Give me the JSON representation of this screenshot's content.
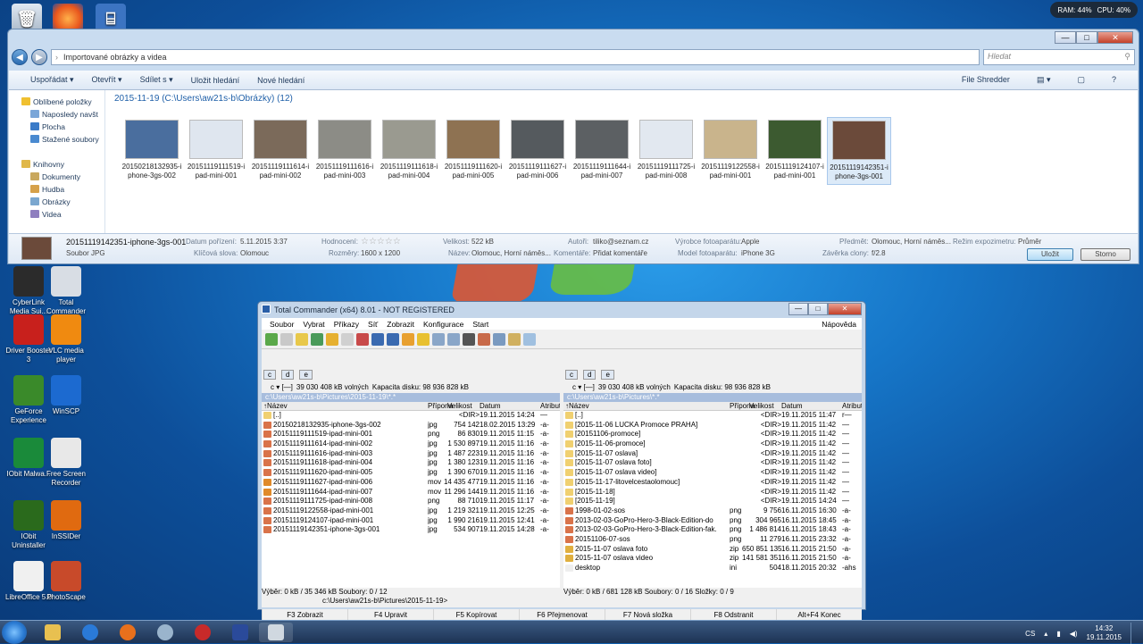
{
  "perf": {
    "ram": "RAM: 44%",
    "cpu": "CPU: 40%"
  },
  "desktop": {
    "icons": [
      "CyberLink Media Sui...",
      "Total Commander",
      "Driver Booster 3",
      "VLC media player",
      "GeForce Experience",
      "WinSCP",
      "IObit Malwa...",
      "Free Screen Recorder",
      "IObit Uninstaller",
      "InSSIDer",
      "LibreOffice 5.0",
      "PhotoScape"
    ]
  },
  "explorer": {
    "address": "Importované obrázky a videa",
    "search_placeholder": "Hledat",
    "toolbar": [
      "Uspořádat ▾",
      "Otevřít ▾",
      "Sdílet s ▾",
      "Uložit hledání",
      "Nové hledání"
    ],
    "toolbar_right": "File Shredder",
    "nav": [
      {
        "label": "Oblíbené položky",
        "sub": false,
        "color": "#f0c030"
      },
      {
        "label": "Naposledy navšt",
        "sub": true,
        "color": "#7aa6d8"
      },
      {
        "label": "Plocha",
        "sub": true,
        "color": "#3a7bc8"
      },
      {
        "label": "Stažené soubory",
        "sub": true,
        "color": "#4a8ad0"
      },
      {
        "label": "",
        "sub": false,
        "color": ""
      },
      {
        "label": "Knihovny",
        "sub": false,
        "color": "#e0b84a"
      },
      {
        "label": "Dokumenty",
        "sub": true,
        "color": "#c9a85e"
      },
      {
        "label": "Hudba",
        "sub": true,
        "color": "#d6a14a"
      },
      {
        "label": "Obrázky",
        "sub": true,
        "color": "#7ba7cf"
      },
      {
        "label": "Videa",
        "sub": true,
        "color": "#8f7fbf"
      }
    ],
    "breadcrumb": "2015-11-19 (C:\\Users\\aw21s-b\\Obrázky) (12)",
    "thumbs": [
      {
        "name": "20150218132935-iphone-3gs-002",
        "line1": "20150218132935-i",
        "line2": "phone-3gs-002",
        "color": "#4a6e9e"
      },
      {
        "name": "20151119111519-ipad-mini-001",
        "line1": "20151119111519-i",
        "line2": "pad-mini-001",
        "color": "#dfe6ef"
      },
      {
        "name": "20151119111614-ipad-mini-002",
        "line1": "20151119111614-i",
        "line2": "pad-mini-002",
        "color": "#7b6a5a"
      },
      {
        "name": "20151119111616-ipad-mini-003",
        "line1": "20151119111616-i",
        "line2": "pad-mini-003",
        "color": "#8c8c86"
      },
      {
        "name": "20151119111618-ipad-mini-004",
        "line1": "20151119111618-i",
        "line2": "pad-mini-004",
        "color": "#9a9a90"
      },
      {
        "name": "20151119111620-ipad-mini-005",
        "line1": "20151119111620-i",
        "line2": "pad-mini-005",
        "color": "#8e7252"
      },
      {
        "name": "20151119111627-ipad-mini-006",
        "line1": "20151119111627-i",
        "line2": "pad-mini-006",
        "color": "#555a5e"
      },
      {
        "name": "20151119111644-ipad-mini-007",
        "line1": "20151119111644-i",
        "line2": "pad-mini-007",
        "color": "#5c6063"
      },
      {
        "name": "20151119111725-ipad-mini-008",
        "line1": "20151119111725-i",
        "line2": "pad-mini-008",
        "color": "#e2e8f0"
      },
      {
        "name": "20151119122558-ipad-mini-001",
        "line1": "20151119122558-i",
        "line2": "pad-mini-001",
        "color": "#c9b48c"
      },
      {
        "name": "20151119124107-ipad-mini-001",
        "line1": "20151119124107-i",
        "line2": "pad-mini-001",
        "color": "#3c5a30"
      },
      {
        "name": "20151119142351-iphone-3gs-001",
        "line1": "20151119142351-i",
        "line2": "phone-3gs-001",
        "color": "#6b4a3a"
      }
    ],
    "details": {
      "filename": "20151119142351-iphone-3gs-001",
      "filetype": "Soubor JPG",
      "date_label": "Datum pořízení:",
      "date_value": "5.11.2015 3:37",
      "keywords_label": "Klíčová slova:",
      "keywords_value": "Olomouc",
      "rating_label": "Hodnocení:",
      "rating_stars": "☆☆☆☆☆",
      "dims_label": "Rozměry:",
      "dims_value": "1600 x 1200",
      "size_label": "Velikost:",
      "size_value": "522 kB",
      "title_label": "Název:",
      "title_value": "Olomouc, Horní náměs...",
      "author_label": "Autoři:",
      "author_value": "tiliko@seznam.cz",
      "comments_label": "Komentáře:",
      "comments_value": "Přidat komentáře",
      "maker_label": "Výrobce fotoaparátu:",
      "maker_value": "Apple",
      "model_label": "Model fotoaparátu:",
      "model_value": "iPhone 3G",
      "subject_label": "Předmět:",
      "subject_value": "Olomouc, Horní náměs...",
      "aperture_label": "Závěrka clony:",
      "aperture_value": "f/2.8",
      "exposure_label": "Režim expozimetru:",
      "exposure_value": "Průměr",
      "save": "Uložit",
      "cancel": "Storno"
    }
  },
  "tc": {
    "title": "Total Commander (x64) 8.01 - NOT REGISTERED",
    "menu": [
      "Soubor",
      "Vybrat",
      "Příkazy",
      "Síť",
      "Zobrazit",
      "Konfigurace",
      "Start"
    ],
    "help": "Nápověda",
    "drives": [
      "c",
      "d",
      "e"
    ],
    "disk_free": "39 030 408 kB volných",
    "disk_cap": "Kapacita disku: 98 936 828 kB",
    "left": {
      "path": "c:\\Users\\aw21s-b\\Pictures\\2015-11-19\\*.*",
      "columns": {
        "name": "↑Název",
        "ext": "Přípona",
        "size": "Velikost",
        "date": "Datum",
        "attr": "Atributy"
      },
      "rows": [
        {
          "name": "[..]",
          "ext": "",
          "size": "<DIR>",
          "date": "19.11.2015 14:24",
          "attr": "—",
          "color": "#f0d070"
        },
        {
          "name": "20150218132935-iphone-3gs-002",
          "ext": "jpg",
          "size": "754 142",
          "date": "18.02.2015 13:29",
          "attr": "-a-",
          "color": "#d9734a"
        },
        {
          "name": "20151119111519-ipad-mini-001",
          "ext": "png",
          "size": "86 830",
          "date": "19.11.2015 11:15",
          "attr": "-a-",
          "color": "#d9734a"
        },
        {
          "name": "20151119111614-ipad-mini-002",
          "ext": "jpg",
          "size": "1 530 897",
          "date": "19.11.2015 11:16",
          "attr": "-a-",
          "color": "#d9734a"
        },
        {
          "name": "20151119111616-ipad-mini-003",
          "ext": "jpg",
          "size": "1 487 223",
          "date": "19.11.2015 11:16",
          "attr": "-a-",
          "color": "#d9734a"
        },
        {
          "name": "20151119111618-ipad-mini-004",
          "ext": "jpg",
          "size": "1 380 123",
          "date": "19.11.2015 11:16",
          "attr": "-a-",
          "color": "#d9734a"
        },
        {
          "name": "20151119111620-ipad-mini-005",
          "ext": "jpg",
          "size": "1 390 670",
          "date": "19.11.2015 11:16",
          "attr": "-a-",
          "color": "#d9734a"
        },
        {
          "name": "20151119111627-ipad-mini-006",
          "ext": "mov",
          "size": "14 435 477",
          "date": "19.11.2015 11:16",
          "attr": "-a-",
          "color": "#e08a2a"
        },
        {
          "name": "20151119111644-ipad-mini-007",
          "ext": "mov",
          "size": "11 296 144",
          "date": "19.11.2015 11:16",
          "attr": "-a-",
          "color": "#e08a2a"
        },
        {
          "name": "20151119111725-ipad-mini-008",
          "ext": "png",
          "size": "88 710",
          "date": "19.11.2015 11:17",
          "attr": "-a-",
          "color": "#d9734a"
        },
        {
          "name": "20151119122558-ipad-mini-001",
          "ext": "jpg",
          "size": "1 219 321",
          "date": "19.11.2015 12:25",
          "attr": "-a-",
          "color": "#d9734a"
        },
        {
          "name": "20151119124107-ipad-mini-001",
          "ext": "jpg",
          "size": "1 990 216",
          "date": "19.11.2015 12:41",
          "attr": "-a-",
          "color": "#d9734a"
        },
        {
          "name": "20151119142351-iphone-3gs-001",
          "ext": "jpg",
          "size": "534 907",
          "date": "19.11.2015 14:28",
          "attr": "-a-",
          "color": "#d9734a"
        }
      ],
      "status": "Výběr: 0 kB / 35 346 kB   Soubory: 0 / 12"
    },
    "right": {
      "path": "c:\\Users\\aw21s-b\\Pictures\\*.*",
      "columns": {
        "name": "↑Název",
        "ext": "Přípona",
        "size": "Velikost",
        "date": "Datum",
        "attr": "Atributy"
      },
      "rows": [
        {
          "name": "[..]",
          "ext": "",
          "size": "<DIR>",
          "date": "19.11.2015 11:47",
          "attr": "r—",
          "color": "#f0d070"
        },
        {
          "name": "[2015-11-06 LUCKA Promoce PRAHA]",
          "ext": "",
          "size": "<DIR>",
          "date": "19.11.2015 11:42",
          "attr": "—",
          "color": "#f0d070"
        },
        {
          "name": "[20151106-promoce]",
          "ext": "",
          "size": "<DIR>",
          "date": "19.11.2015 11:42",
          "attr": "—",
          "color": "#f0d070"
        },
        {
          "name": "[2015-11-06-promoce]",
          "ext": "",
          "size": "<DIR>",
          "date": "19.11.2015 11:42",
          "attr": "—",
          "color": "#f0d070"
        },
        {
          "name": "[2015-11-07 oslava]",
          "ext": "",
          "size": "<DIR>",
          "date": "19.11.2015 11:42",
          "attr": "—",
          "color": "#f0d070"
        },
        {
          "name": "[2015-11-07 oslava foto]",
          "ext": "",
          "size": "<DIR>",
          "date": "19.11.2015 11:42",
          "attr": "—",
          "color": "#f0d070"
        },
        {
          "name": "[2015-11-07 oslava video]",
          "ext": "",
          "size": "<DIR>",
          "date": "19.11.2015 11:42",
          "attr": "—",
          "color": "#f0d070"
        },
        {
          "name": "[2015-11-17-litovelcestaolomouc]",
          "ext": "",
          "size": "<DIR>",
          "date": "19.11.2015 11:42",
          "attr": "—",
          "color": "#f0d070"
        },
        {
          "name": "[2015-11-18]",
          "ext": "",
          "size": "<DIR>",
          "date": "19.11.2015 11:42",
          "attr": "—",
          "color": "#f0d070"
        },
        {
          "name": "[2015-11-19]",
          "ext": "",
          "size": "<DIR>",
          "date": "19.11.2015 14:24",
          "attr": "—",
          "color": "#f0d070"
        },
        {
          "name": "1998-01-02-sos",
          "ext": "png",
          "size": "9 756",
          "date": "16.11.2015 16:30",
          "attr": "-a-",
          "color": "#d9734a"
        },
        {
          "name": "2013-02-03-GoPro-Hero-3-Black-Edition-do",
          "ext": "png",
          "size": "304 965",
          "date": "16.11.2015 18:45",
          "attr": "-a-",
          "color": "#d9734a"
        },
        {
          "name": "2013-02-03-GoPro-Hero-3-Black-Edition-fak.",
          "ext": "png",
          "size": "1 486 814",
          "date": "16.11.2015 18:43",
          "attr": "-a-",
          "color": "#d9734a"
        },
        {
          "name": "20151106-07-sos",
          "ext": "png",
          "size": "11 279",
          "date": "16.11.2015 23:32",
          "attr": "-a-",
          "color": "#d9734a"
        },
        {
          "name": "2015-11-07 oslava foto",
          "ext": "zip",
          "size": "650 851 135",
          "date": "16.11.2015 21:50",
          "attr": "-a-",
          "color": "#e0b040"
        },
        {
          "name": "2015-11-07 oslava video",
          "ext": "zip",
          "size": "141 581 351",
          "date": "16.11.2015 21:50",
          "attr": "-a-",
          "color": "#e0b040"
        },
        {
          "name": "desktop",
          "ext": "ini",
          "size": "504",
          "date": "18.11.2015 20:32",
          "attr": "-ahs",
          "color": "#eeeeee"
        }
      ],
      "status": "Výběr: 0 kB / 681 128 kB   Soubory: 0 / 16   Složky: 0 / 9"
    },
    "cmdline": "c:\\Users\\aw21s-b\\Pictures\\2015-11-19>",
    "fkeys": [
      "F3 Zobrazit",
      "F4 Upravit",
      "F5 Kopírovat",
      "F6 Přejmenovat",
      "F7 Nová složka",
      "F8 Odstranit",
      "Alt+F4 Konec"
    ]
  },
  "taskbar": {
    "lang": "CS",
    "time": "14:32",
    "date": "19.11.2015"
  }
}
